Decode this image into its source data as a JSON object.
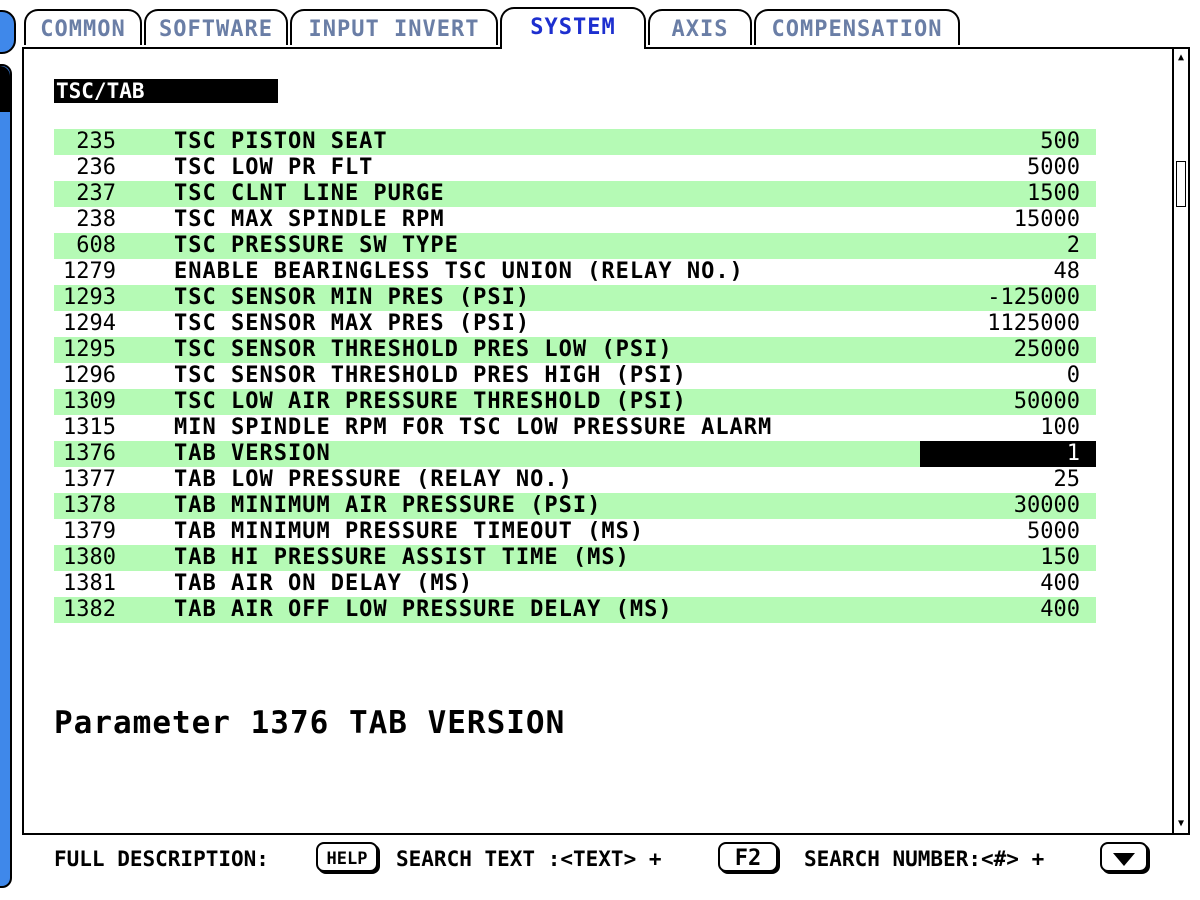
{
  "tabs": [
    {
      "label": "COMMON",
      "active": false
    },
    {
      "label": "SOFTWARE",
      "active": false
    },
    {
      "label": "INPUT INVERT",
      "active": false
    },
    {
      "label": "SYSTEM",
      "active": true
    },
    {
      "label": "AXIS",
      "active": false
    },
    {
      "label": "COMPENSATION",
      "active": false
    }
  ],
  "section_title": "TSC/TAB",
  "params": [
    {
      "num": "235",
      "name": "TSC PISTON SEAT",
      "value": "500"
    },
    {
      "num": "236",
      "name": "TSC LOW PR FLT",
      "value": "5000"
    },
    {
      "num": "237",
      "name": "TSC CLNT LINE PURGE",
      "value": "1500"
    },
    {
      "num": "238",
      "name": "TSC MAX SPINDLE RPM",
      "value": "15000"
    },
    {
      "num": "608",
      "name": "TSC PRESSURE SW TYPE",
      "value": "2"
    },
    {
      "num": "1279",
      "name": "ENABLE BEARINGLESS TSC UNION (RELAY NO.)",
      "value": "48"
    },
    {
      "num": "1293",
      "name": "TSC SENSOR MIN PRES (PSI)",
      "value": "-125000"
    },
    {
      "num": "1294",
      "name": "TSC SENSOR MAX PRES (PSI)",
      "value": "1125000"
    },
    {
      "num": "1295",
      "name": "TSC SENSOR THRESHOLD PRES LOW (PSI)",
      "value": "25000"
    },
    {
      "num": "1296",
      "name": "TSC SENSOR THRESHOLD PRES HIGH (PSI)",
      "value": "0"
    },
    {
      "num": "1309",
      "name": "TSC LOW AIR PRESSURE THRESHOLD (PSI)",
      "value": "50000"
    },
    {
      "num": "1315",
      "name": "MIN SPINDLE RPM FOR TSC LOW PRESSURE ALARM",
      "value": "100"
    },
    {
      "num": "1376",
      "name": "TAB VERSION",
      "value": "1",
      "selected": true
    },
    {
      "num": "1377",
      "name": "TAB LOW PRESSURE (RELAY NO.)",
      "value": "25"
    },
    {
      "num": "1378",
      "name": "TAB MINIMUM AIR PRESSURE (PSI)",
      "value": "30000"
    },
    {
      "num": "1379",
      "name": "TAB MINIMUM PRESSURE TIMEOUT (MS)",
      "value": "5000"
    },
    {
      "num": "1380",
      "name": "TAB HI PRESSURE ASSIST TIME (MS)",
      "value": "150"
    },
    {
      "num": "1381",
      "name": "TAB AIR ON DELAY (MS)",
      "value": "400"
    },
    {
      "num": "1382",
      "name": "TAB AIR OFF LOW PRESSURE DELAY (MS)",
      "value": "400"
    }
  ],
  "detail": "Parameter 1376 TAB VERSION",
  "helpbar": {
    "full_description_label": "FULL DESCRIPTION:",
    "help_key": "HELP",
    "search_text_label": "SEARCH TEXT :<TEXT> +",
    "f2_key": "F2",
    "search_number_label": "SEARCH NUMBER:<#> +",
    "down_key_icon": "down-arrow-icon"
  },
  "colors": {
    "row_highlight": "#b5fab5",
    "active_tab_text": "#1d2fcf",
    "inactive_tab_text": "#6a7ea6",
    "rail": "#3f88ea"
  }
}
